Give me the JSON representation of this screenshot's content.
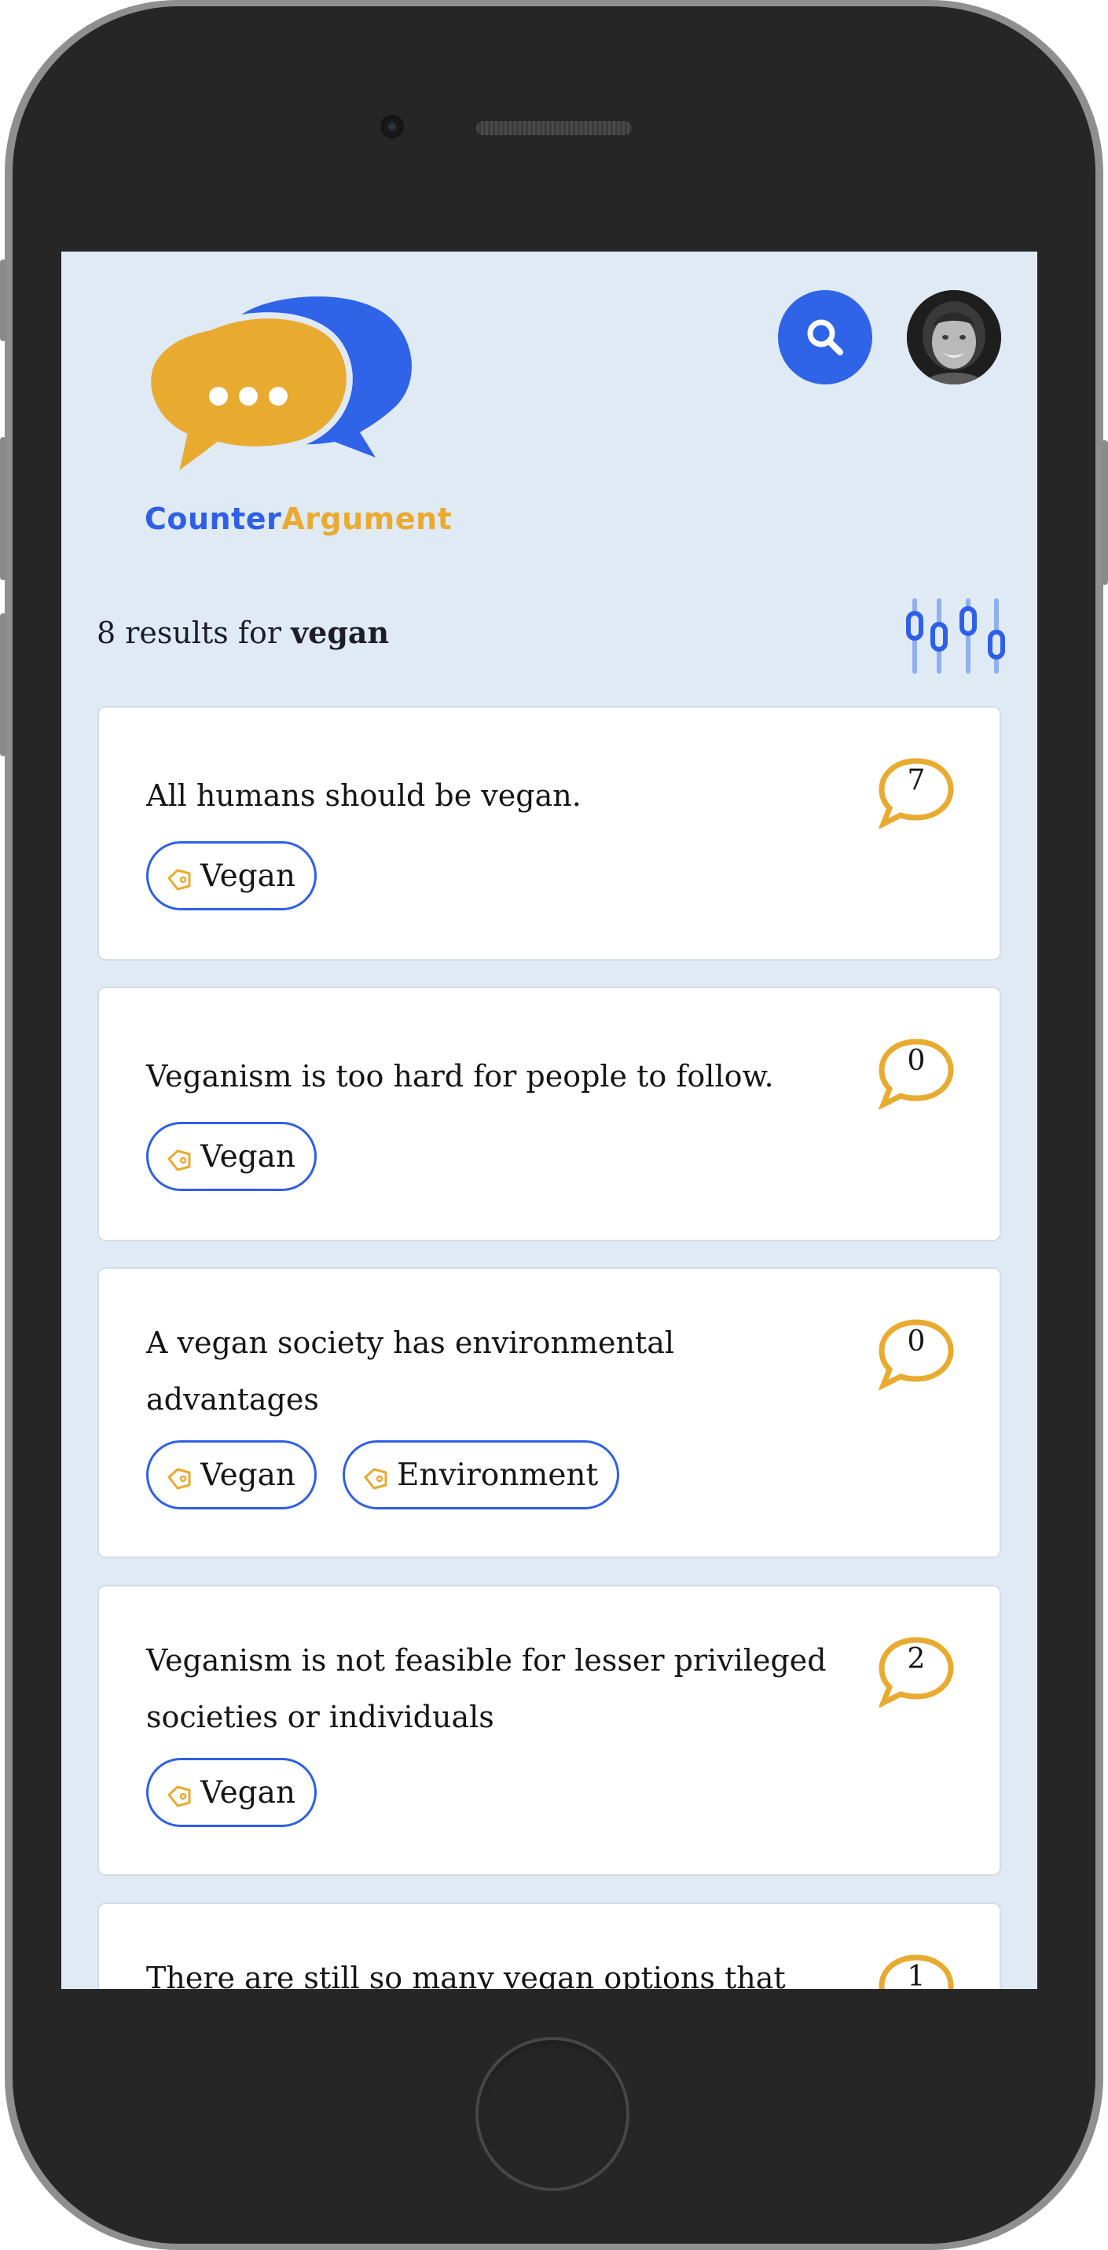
{
  "app": {
    "name_part1": "Counter",
    "name_part2": "Argument",
    "brand_blue": "#2f5fe8",
    "brand_yellow": "#e9aa30",
    "screen_bg": "#dfeaf5"
  },
  "header": {
    "search_icon": "search-icon",
    "avatar_icon": "user-avatar",
    "filter_icon": "sliders-icon"
  },
  "results": {
    "prefix": "8 results for ",
    "query": "vegan"
  },
  "cards": [
    {
      "title": "All humans should be vegan.",
      "count": "7",
      "tags": [
        "Vegan"
      ]
    },
    {
      "title": "Veganism is too hard for people to follow.",
      "count": "0",
      "tags": [
        "Vegan"
      ]
    },
    {
      "title": "A vegan society has environmental advantages",
      "count": "0",
      "tags": [
        "Vegan",
        "Environment"
      ]
    },
    {
      "title": "Veganism is not feasible for lesser privileged societies or individuals",
      "count": "2",
      "tags": [
        "Vegan"
      ]
    },
    {
      "title": "There are still so many vegan options that",
      "count": "1",
      "tags": []
    }
  ]
}
